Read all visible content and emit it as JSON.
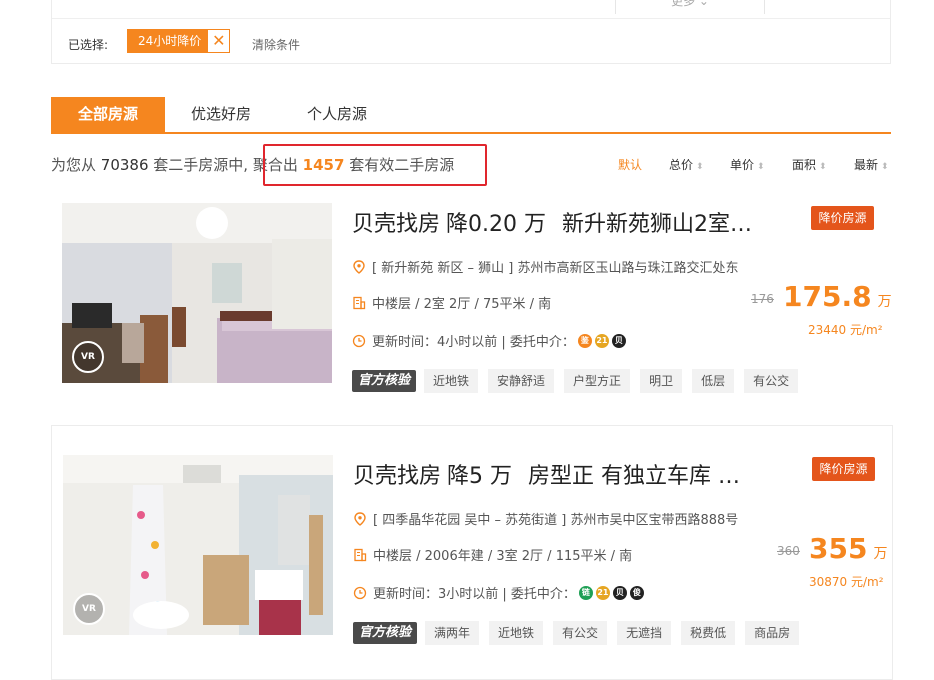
{
  "filter": {
    "more_label": "更多 ⌄",
    "selected_label": "已选择:",
    "chip_label": "24小时降价",
    "clear_label": "清除条件"
  },
  "tabs": [
    {
      "label": "全部房源",
      "active": true
    },
    {
      "label": "优选好房",
      "active": false
    },
    {
      "label": "个人房源",
      "active": false
    }
  ],
  "summary": {
    "prefix": "为您从",
    "total": "70386",
    "middle": "套二手房源中,",
    "agg_prefix": "聚合出",
    "count": "1457",
    "agg_suffix": "套有效二手房源"
  },
  "sorts": [
    {
      "label": "默认",
      "active": true
    },
    {
      "label": "总价",
      "active": false
    },
    {
      "label": "单价",
      "active": false
    },
    {
      "label": "面积",
      "active": false
    },
    {
      "label": "最新",
      "active": false
    }
  ],
  "listings": [
    {
      "title_brand": "贝壳找房",
      "title_drop": "降0.20 万",
      "title_text": "新升新苑狮山2室…",
      "badge": "降价房源",
      "address": "[ 新升新苑 新区 – 狮山 ] 苏州市高新区玉山路与珠江路交汇处东",
      "details": "中楼层 / 2室 2厅 / 75平米 / 南",
      "update": "更新时间：4小时以前 | 委托中介：",
      "agents": [
        {
          "text": "鉴",
          "color": "#f5861f"
        },
        {
          "text": "21",
          "color": "#e6a623"
        },
        {
          "text": "贝",
          "color": "#222222"
        }
      ],
      "official_tag": "官方核验",
      "tags": [
        "近地铁",
        "安静舒适",
        "户型方正",
        "明卫",
        "低层",
        "有公交"
      ],
      "old_price": "176",
      "price": "175.8",
      "price_unit": "万",
      "unit_price": "23440 元/m²",
      "vr_label": "VR"
    },
    {
      "title_brand": "贝壳找房",
      "title_drop": "降5 万",
      "title_text": "房型正 有独立车库 …",
      "badge": "降价房源",
      "address": "[ 四季晶华花园 吴中 – 苏苑街道 ] 苏州市吴中区宝带西路888号",
      "details": "中楼层 / 2006年建 / 3室 2厅 / 115平米 / 南",
      "update": "更新时间：3小时以前 | 委托中介：",
      "agents": [
        {
          "text": "链",
          "color": "#1fa055"
        },
        {
          "text": "21",
          "color": "#e6a623"
        },
        {
          "text": "贝",
          "color": "#222222"
        },
        {
          "text": "俊",
          "color": "#222222"
        }
      ],
      "official_tag": "官方核验",
      "tags": [
        "满两年",
        "近地铁",
        "有公交",
        "无遮挡",
        "税费低",
        "商品房"
      ],
      "old_price": "360",
      "price": "355",
      "price_unit": "万",
      "unit_price": "30870 元/m²",
      "vr_label": "VR"
    }
  ],
  "colors": {
    "accent": "#f5861f",
    "badge": "#e4551b",
    "highlight_box": "#e0262d"
  }
}
